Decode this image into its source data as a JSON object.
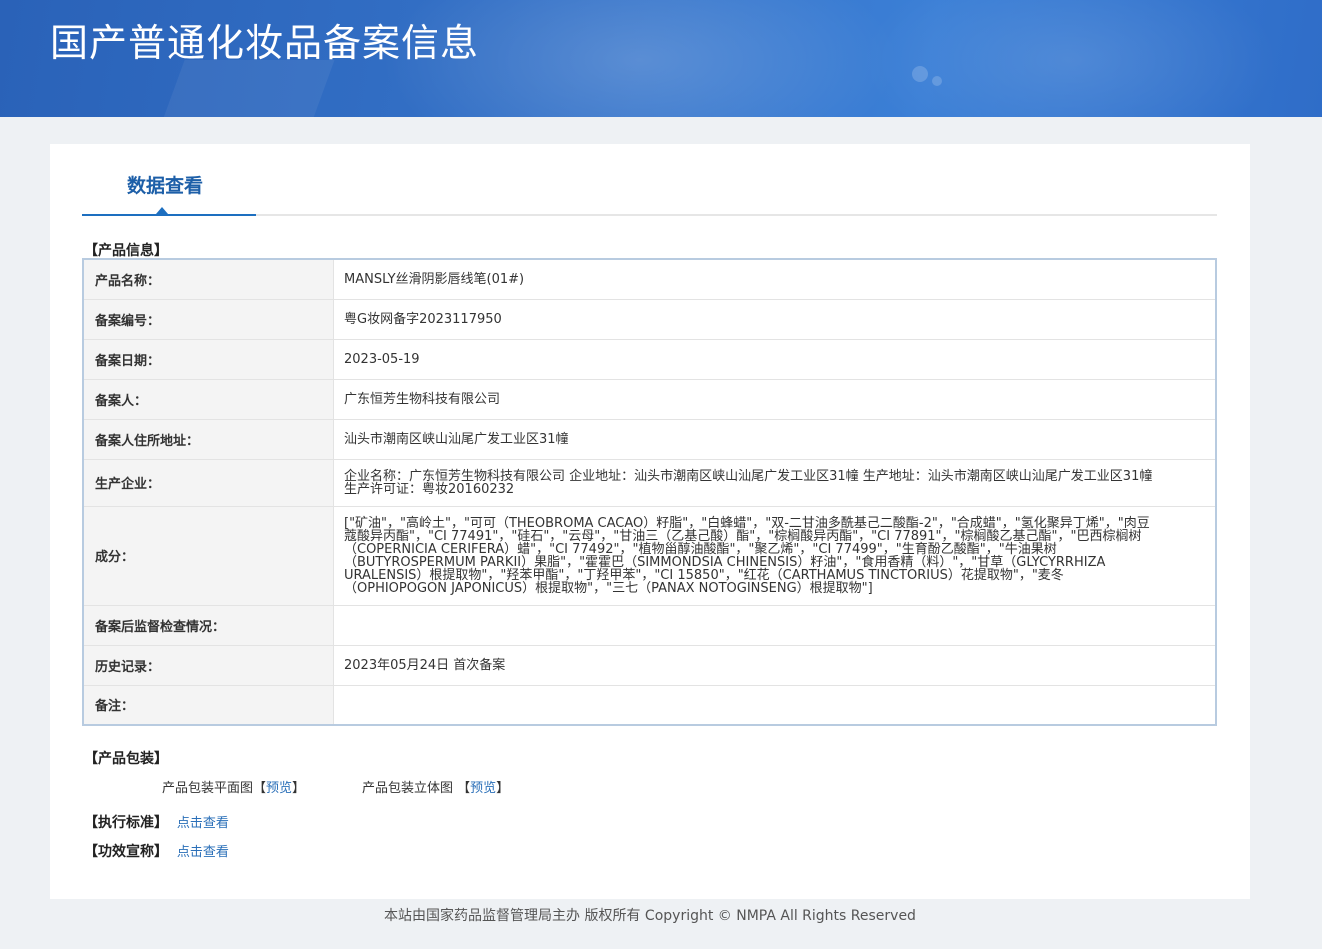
{
  "header": {
    "title": "国产普通化妆品备案信息"
  },
  "tabs": [
    {
      "label": "数据查看",
      "active": true
    }
  ],
  "product_info": {
    "heading": "【产品信息】",
    "rows": [
      {
        "label": "产品名称：",
        "value": "MANSLY丝滑阴影唇线笔(01#)"
      },
      {
        "label": "备案编号：",
        "value": "粤G妆网备字2023117950"
      },
      {
        "label": "备案日期：",
        "value": "2023-05-19"
      },
      {
        "label": "备案人：",
        "value": "广东恒芳生物科技有限公司"
      },
      {
        "label": "备案人住所地址：",
        "value": "汕头市潮南区峡山汕尾广发工业区31幢"
      },
      {
        "label": "生产企业：",
        "value": "企业名称：广东恒芳生物科技有限公司 企业地址：汕头市潮南区峡山汕尾广发工业区31幢 生产地址：汕头市潮南区峡山汕尾广发工业区31幢 生产许可证：粤妆20160232"
      },
      {
        "label": "成分：",
        "value": "[\"矿油\"，\"高岭土\"，\"可可（THEOBROMA CACAO）籽脂\"，\"白蜂蜡\"，\"双-二甘油多酰基己二酸酯-2\"，\"合成蜡\"，\"氢化聚异丁烯\"，\"肉豆蔻酸异丙酯\"，\"CI 77491\"，\"硅石\"，\"云母\"，\"甘油三（乙基己酸）酯\"，\"棕榈酸异丙酯\"，\"CI 77891\"，\"棕榈酸乙基己酯\"，\"巴西棕榈树（COPERNICIA CERIFERA）蜡\"，\"CI 77492\"，\"植物甾醇油酸酯\"，\"聚乙烯\"，\"CI 77499\"，\"生育酚乙酸酯\"，\"牛油果树（BUTYROSPERMUM PARKII）果脂\"，\"霍霍巴（SIMMONDSIA CHINENSIS）籽油\"，\"食用香精（料）\"，\"甘草（GLYCYRRHIZA URALENSIS）根提取物\"，\"羟苯甲酯\"，\"丁羟甲苯\"，\"CI 15850\"，\"红花（CARTHAMUS TINCTORIUS）花提取物\"，\"麦冬（OPHIOPOGON JAPONICUS）根提取物\"，\"三七（PANAX NOTOGINSENG）根提取物\"]"
      },
      {
        "label": "备案后监督检查情况：",
        "value": ""
      },
      {
        "label": "历史记录：",
        "value": "2023年05月24日 首次备案"
      },
      {
        "label": "备注：",
        "value": ""
      }
    ]
  },
  "packaging": {
    "heading": "【产品包装】",
    "items": [
      {
        "label": "产品包装平面图",
        "bracket_open": "【",
        "link": "预览",
        "bracket_close": "】"
      },
      {
        "label": "产品包装立体图 ",
        "bracket_open": "【",
        "link": "预览",
        "bracket_close": "】"
      }
    ]
  },
  "standard": {
    "heading": "【执行标准】",
    "link": "点击查看"
  },
  "efficacy": {
    "heading": "【功效宣称】",
    "link": "点击查看"
  },
  "footer": {
    "text": "本站由国家药品监督管理局主办 版权所有 Copyright © NMPA All Rights Reserved"
  },
  "colors": {
    "banner": "#3070c8",
    "accent": "#1d5fa8",
    "link": "#2a6fb8",
    "page_bg": "#eef1f4"
  }
}
